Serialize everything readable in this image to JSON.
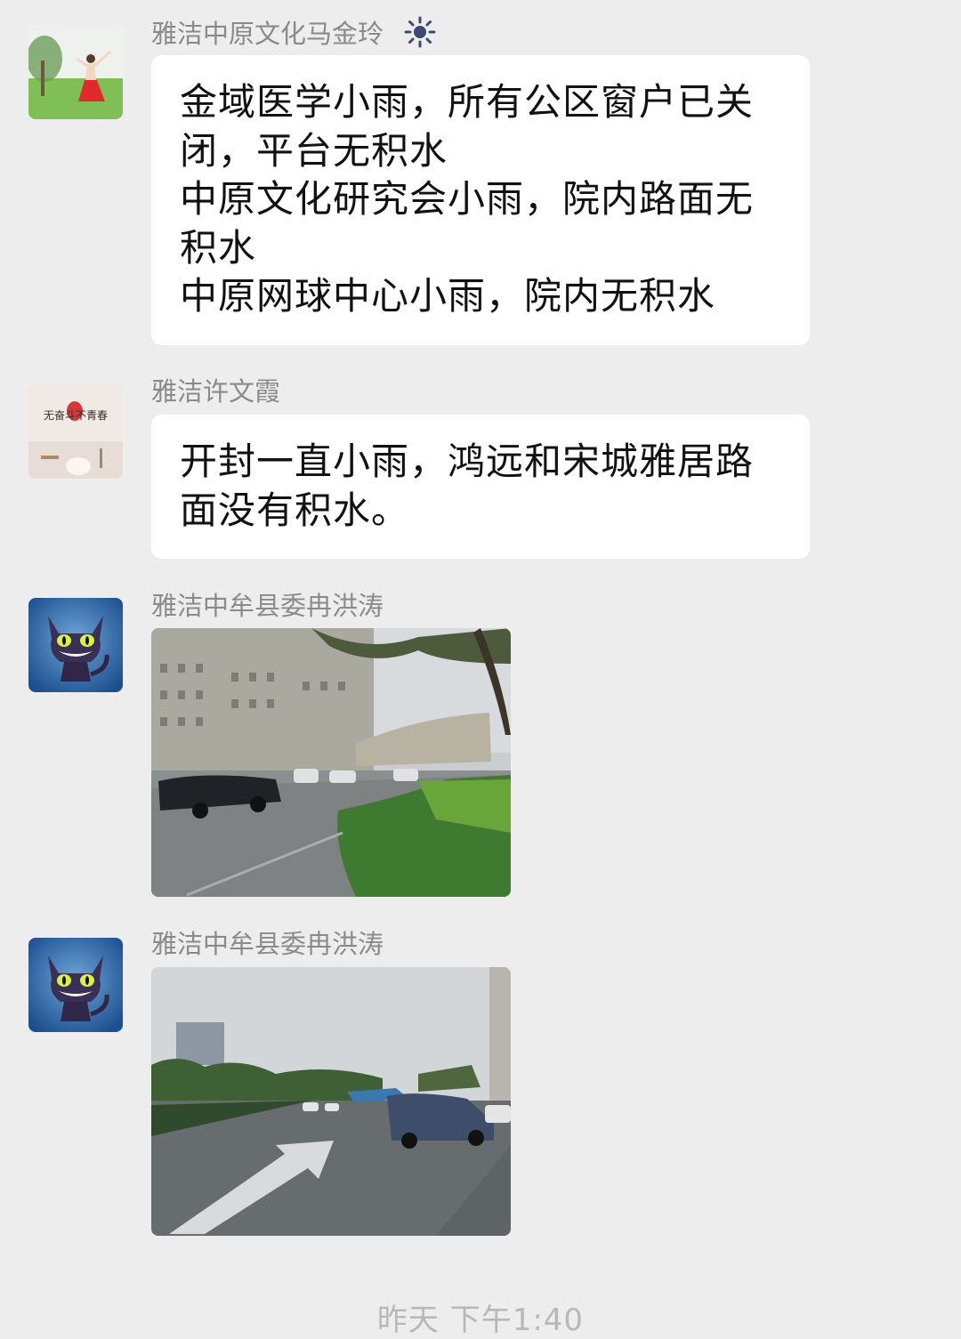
{
  "messages": [
    {
      "sender": "雅洁中原文化马金玲",
      "lines": [
        "金域医学小雨，所有公区窗户已关",
        "闭，平台无积水",
        "中原文化研究会小雨，院内路面无",
        "积水",
        "中原网球中心小雨，院内无积水"
      ]
    },
    {
      "sender": "雅洁许文霞",
      "avatar_text": "无奋斗不青春",
      "lines": [
        "开封一直小雨，鸿远和宋城雅居路",
        "面没有积水。"
      ]
    },
    {
      "sender": "雅洁中牟县委冉洪涛",
      "photo": "rainy-parking-lot-photo"
    },
    {
      "sender": "雅洁中牟县委冉洪涛",
      "photo": "rainy-road-arrow-photo"
    }
  ],
  "timestamp": "昨天 下午1:40",
  "colors": {
    "background": "#ededed",
    "bubble": "#ffffff",
    "sender_text": "#8a8a8a"
  }
}
